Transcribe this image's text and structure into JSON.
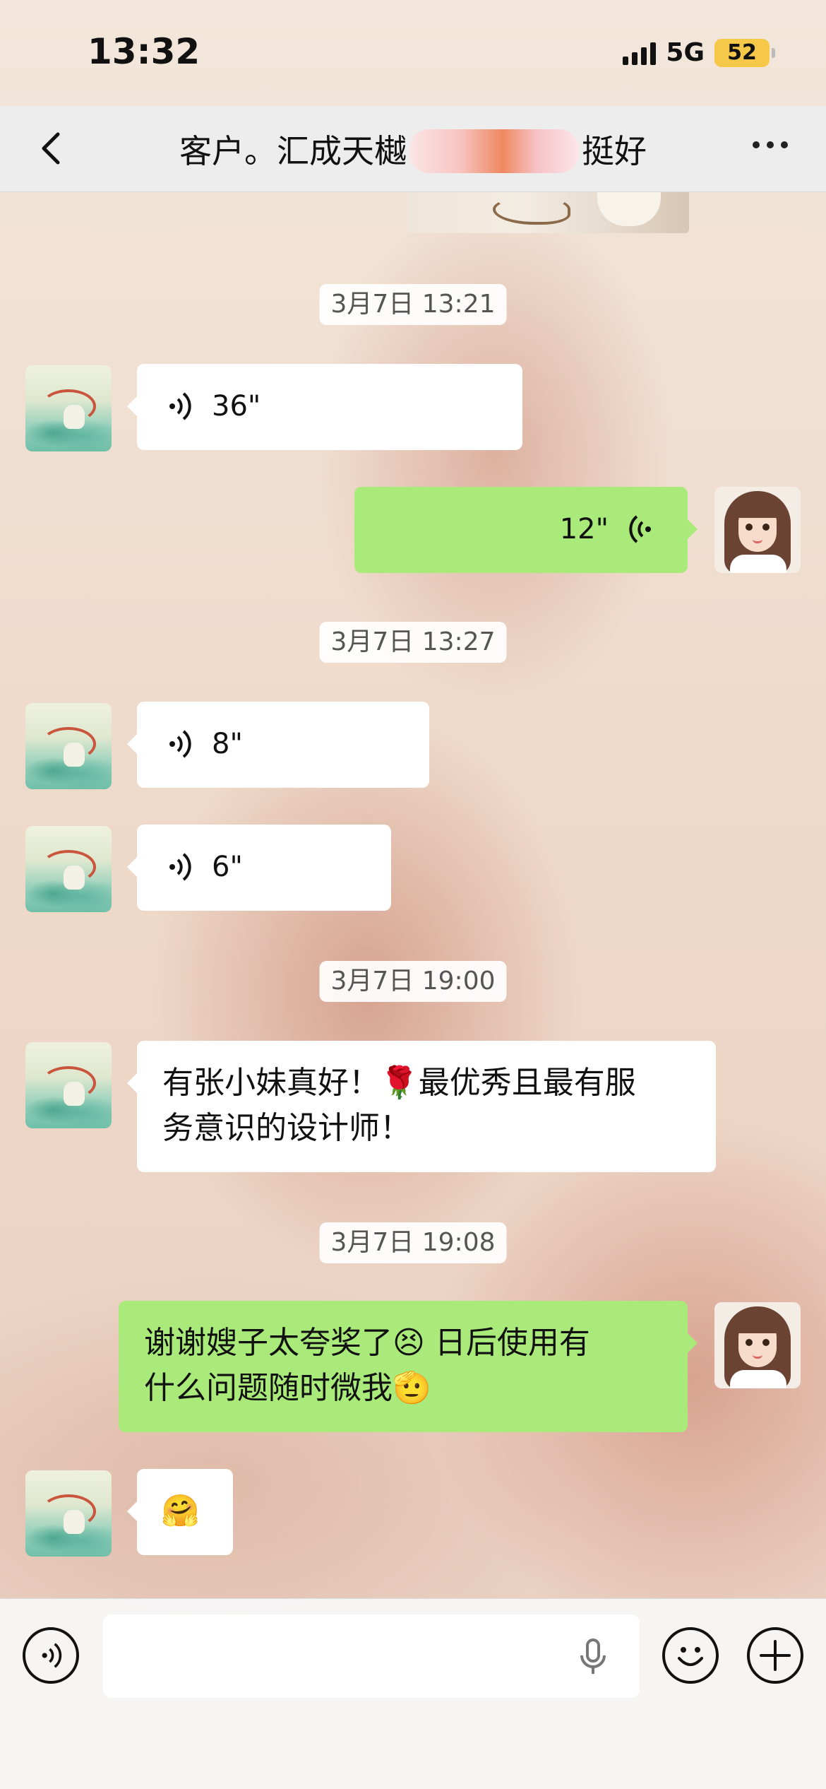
{
  "status_bar": {
    "time": "13:32",
    "network": "5G",
    "battery": "52"
  },
  "nav": {
    "title_prefix": "客户。汇成天樾",
    "title_suffix": "挺好"
  },
  "messages": [
    {
      "timestamp": "3月7日 13:21"
    },
    {
      "sender": "contact",
      "type": "voice",
      "duration": "36\""
    },
    {
      "sender": "me",
      "type": "voice",
      "duration": "12\""
    },
    {
      "timestamp": "3月7日 13:27"
    },
    {
      "sender": "contact",
      "type": "voice",
      "duration": "8\""
    },
    {
      "sender": "contact",
      "type": "voice",
      "duration": "6\""
    },
    {
      "timestamp": "3月7日 19:00"
    },
    {
      "sender": "contact",
      "type": "text",
      "line1": "有张小妹真好！🌹最优秀且最有服",
      "line2": "务意识的设计师！"
    },
    {
      "timestamp": "3月7日 19:08"
    },
    {
      "sender": "me",
      "type": "text",
      "line1": "谢谢嫂子太夸奖了😣 日后使用有",
      "line2": "什么问题随时微我🫡"
    },
    {
      "sender": "contact",
      "type": "emoji",
      "emoji": "🤗"
    }
  ]
}
